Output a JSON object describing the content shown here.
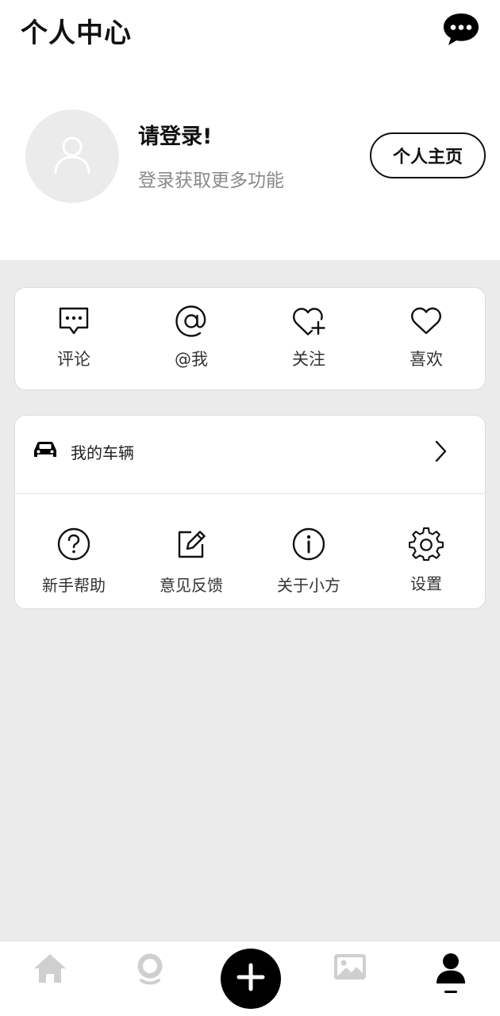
{
  "header": {
    "title": "个人中心",
    "message_icon": "chat-bubble-icon"
  },
  "profile": {
    "avatar_icon": "user-outline-icon",
    "login_title": "请登录!",
    "login_subtitle": "登录获取更多功能",
    "homepage_button": "个人主页"
  },
  "actions": [
    {
      "label": "评论",
      "icon": "comment-icon"
    },
    {
      "label": "@我",
      "icon": "at-icon"
    },
    {
      "label": "关注",
      "icon": "heart-plus-icon"
    },
    {
      "label": "喜欢",
      "icon": "heart-icon"
    }
  ],
  "vehicle": {
    "label": "我的车辆",
    "icon": "car-icon",
    "chevron": "chevron-right-icon"
  },
  "tools": [
    {
      "label": "新手帮助",
      "icon": "question-circle-icon"
    },
    {
      "label": "意见反馈",
      "icon": "edit-icon"
    },
    {
      "label": "关于小方",
      "icon": "info-circle-icon"
    },
    {
      "label": "设置",
      "icon": "gear-icon"
    }
  ],
  "tabbar": {
    "items": [
      {
        "name": "home",
        "icon": "home-icon",
        "active": false
      },
      {
        "name": "camera",
        "icon": "camera-icon",
        "active": false
      },
      {
        "name": "add",
        "icon": "plus-icon",
        "active": false
      },
      {
        "name": "gallery",
        "icon": "image-icon",
        "active": false
      },
      {
        "name": "me",
        "icon": "person-icon",
        "active": true
      }
    ]
  },
  "colors": {
    "background": "#ebebeb",
    "surface": "#ffffff",
    "text_primary": "#111111",
    "text_secondary": "#8a8a8a",
    "inactive_icon": "#cfcfcf",
    "accent": "#000000"
  }
}
